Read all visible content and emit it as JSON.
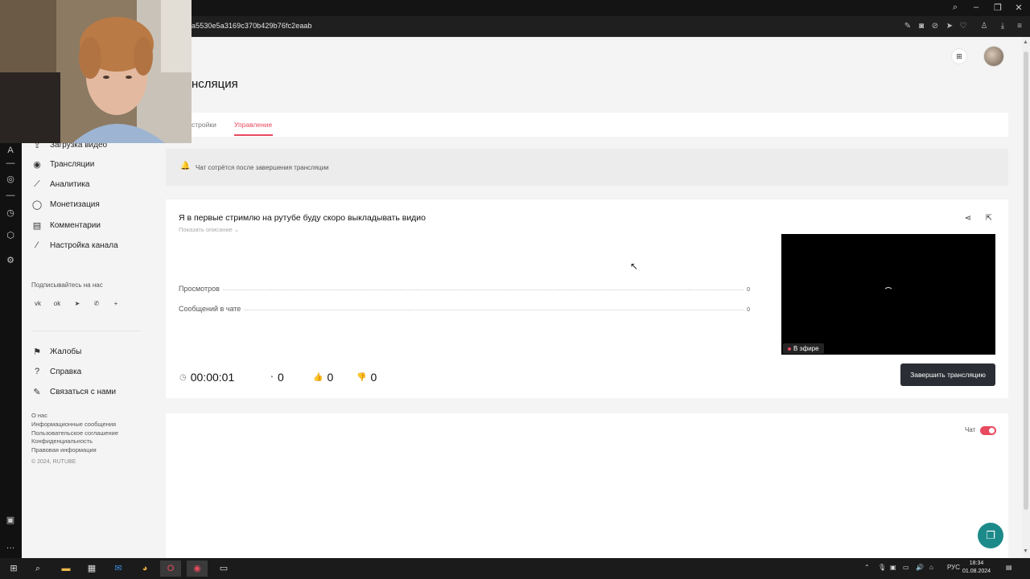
{
  "browser": {
    "url": "a5530e5a3169c370b429b76fc2eaab"
  },
  "page": {
    "title": "нсляция"
  },
  "tabs": [
    {
      "label": "стройки",
      "active": false
    },
    {
      "label": "Управление",
      "active": true
    }
  ],
  "nav": {
    "items": [
      {
        "label": "Загрузка видео",
        "icon": "upload-icon"
      },
      {
        "label": "Трансляции",
        "icon": "broadcast-icon"
      },
      {
        "label": "Аналитика",
        "icon": "analytics-icon"
      },
      {
        "label": "Монетизация",
        "icon": "coin-icon"
      },
      {
        "label": "Комментарии",
        "icon": "comments-icon"
      },
      {
        "label": "Настройка канала",
        "icon": "magic-wand-icon"
      }
    ],
    "subscribe_label": "Подписывайтесь на нас",
    "social": [
      "vk-icon",
      "ok-icon",
      "telegram-icon",
      "viber-icon",
      "plus-icon"
    ],
    "secondary": [
      {
        "label": "Жалобы",
        "icon": "flag-icon"
      },
      {
        "label": "Справка",
        "icon": "help-icon"
      },
      {
        "label": "Связаться с нами",
        "icon": "pencil-icon"
      }
    ],
    "footer_links": [
      "О нас",
      "Информационные сообщения",
      "Пользовательское соглашение",
      "Конфиденциальность",
      "Правовая информация"
    ],
    "copyright": "© 2024, RUTUBE"
  },
  "notice": {
    "text": "Чат сотрётся после завершения трансляции"
  },
  "stream": {
    "title": "Я в первые стримлю на рутубе буду скоро выкладывать видио",
    "show_description": "Показать описание ⌄",
    "stats": [
      {
        "label": "Просмотров",
        "value": "0"
      },
      {
        "label": "Сообщений в чате",
        "value": "0"
      }
    ],
    "live_badge": "В эфире",
    "timer": "00:00:01",
    "viewers": "0",
    "likes": "0",
    "dislikes": "0",
    "end_button": "Завершить трансляцию"
  },
  "chat": {
    "label": "Чат",
    "enabled": true
  },
  "taskbar": {
    "lang": "РУС",
    "time": "18:34",
    "date": "01.08.2024"
  },
  "colors": {
    "accent": "#e84a5f",
    "button_dark": "#2a2d33",
    "fab": "#1d8a8a"
  }
}
